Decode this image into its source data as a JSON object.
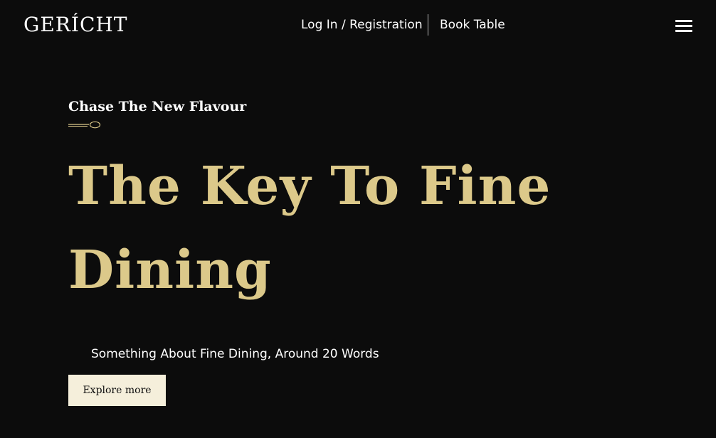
{
  "header": {
    "logo": "GERÍCHT",
    "nav": {
      "login_label": "Log In / Registration",
      "book_label": "Book Table"
    },
    "menu_icon": "hamburger-menu-icon"
  },
  "hero": {
    "tagline": "Chase The New Flavour",
    "decoration_icon": "spoon-icon",
    "headline": "The Key To Fine Dining",
    "subtext": "Something About Fine Dining, Around 20 Words",
    "cta_label": "Explore more"
  },
  "colors": {
    "background": "#0c0c0c",
    "accent_gold": "#dcc98a",
    "button_background": "#f5efdb",
    "text": "#ffffff"
  }
}
